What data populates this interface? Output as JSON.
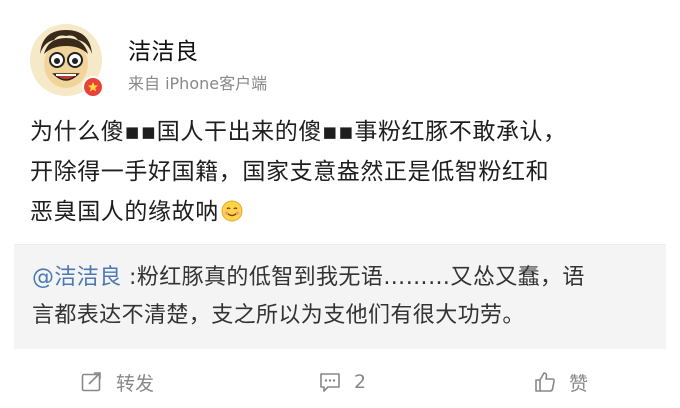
{
  "user": {
    "name": "洁洁良",
    "source": "来自 iPhone客户端"
  },
  "post": {
    "lines": [
      "为什么傻▪▪国人干出来的傻▪▪事粉红豚不敢承认，",
      "开除得一手好国籍，国家支意盎然正是低智粉红和",
      "恶臭国人的缘故呐"
    ]
  },
  "quote": {
    "mention": "@洁洁良",
    "text_line1": " :粉红豚真的低智到我无语………又怂又蠢，语",
    "text_line2": "言都表达不清楚，支之所以为支他们有很大功劳。"
  },
  "toolbar": {
    "repost_label": "转发",
    "comment_count": "2",
    "like_label": "赞"
  },
  "icons": {
    "avatar": "cartoon-face-avatar",
    "badge": "verified-badge-icon",
    "emoji": "smile-emoji-icon",
    "repost": "repost-icon",
    "comment": "comment-icon",
    "like": "thumbs-up-icon"
  },
  "colors": {
    "mention": "#4a79b5",
    "badge": "#e8433a",
    "muted": "#888888"
  }
}
